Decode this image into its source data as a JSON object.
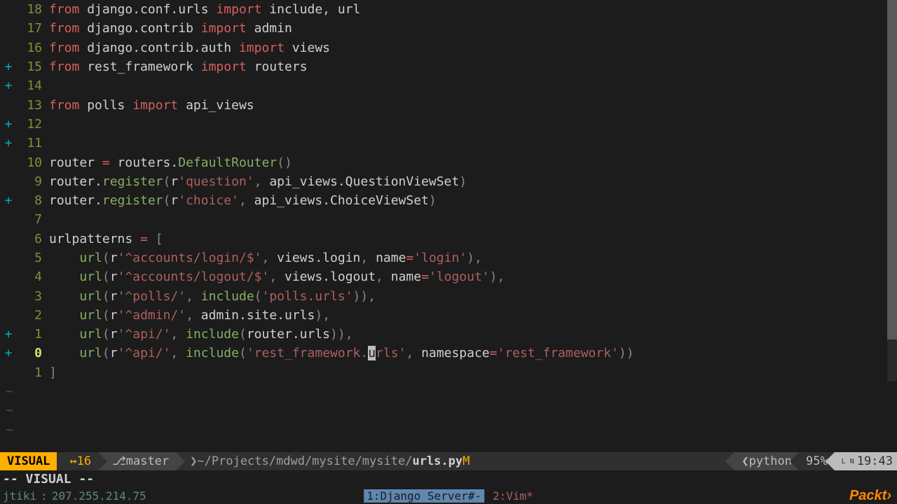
{
  "lines": [
    {
      "sign": "",
      "num": "18",
      "tokens": [
        {
          "c": "kw",
          "t": "from"
        },
        {
          "c": "ident",
          "t": " django.conf.urls "
        },
        {
          "c": "kw",
          "t": "import"
        },
        {
          "c": "ident",
          "t": " include, url"
        }
      ]
    },
    {
      "sign": "",
      "num": "17",
      "tokens": [
        {
          "c": "kw",
          "t": "from"
        },
        {
          "c": "ident",
          "t": " django.contrib "
        },
        {
          "c": "kw",
          "t": "import"
        },
        {
          "c": "ident",
          "t": " admin"
        }
      ]
    },
    {
      "sign": "",
      "num": "16",
      "tokens": [
        {
          "c": "kw",
          "t": "from"
        },
        {
          "c": "ident",
          "t": " django.contrib.auth "
        },
        {
          "c": "kw",
          "t": "import"
        },
        {
          "c": "ident",
          "t": " views"
        }
      ]
    },
    {
      "sign": "+",
      "num": "15",
      "tokens": [
        {
          "c": "kw",
          "t": "from"
        },
        {
          "c": "ident",
          "t": " rest_framework "
        },
        {
          "c": "kw",
          "t": "import"
        },
        {
          "c": "ident",
          "t": " routers"
        }
      ]
    },
    {
      "sign": "+",
      "num": "14",
      "tokens": []
    },
    {
      "sign": "",
      "num": "13",
      "tokens": [
        {
          "c": "kw",
          "t": "from"
        },
        {
          "c": "ident",
          "t": " polls "
        },
        {
          "c": "kw",
          "t": "import"
        },
        {
          "c": "ident",
          "t": " api_views"
        }
      ]
    },
    {
      "sign": "+",
      "num": "12",
      "tokens": []
    },
    {
      "sign": "+",
      "num": "11",
      "tokens": []
    },
    {
      "sign": "",
      "num": "10",
      "tokens": [
        {
          "c": "ident",
          "t": "router "
        },
        {
          "c": "op",
          "t": "="
        },
        {
          "c": "ident",
          "t": " routers."
        },
        {
          "c": "func",
          "t": "DefaultRouter"
        },
        {
          "c": "punct",
          "t": "()"
        }
      ]
    },
    {
      "sign": "",
      "num": "9",
      "tokens": [
        {
          "c": "ident",
          "t": "router."
        },
        {
          "c": "func",
          "t": "register"
        },
        {
          "c": "punct",
          "t": "("
        },
        {
          "c": "ident",
          "t": "r"
        },
        {
          "c": "str",
          "t": "'question'"
        },
        {
          "c": "punct",
          "t": ", "
        },
        {
          "c": "ident",
          "t": "api_views.QuestionViewSet"
        },
        {
          "c": "punct",
          "t": ")"
        }
      ]
    },
    {
      "sign": "+",
      "num": "8",
      "tokens": [
        {
          "c": "ident",
          "t": "router."
        },
        {
          "c": "func",
          "t": "register"
        },
        {
          "c": "punct",
          "t": "("
        },
        {
          "c": "ident",
          "t": "r"
        },
        {
          "c": "str",
          "t": "'choice'"
        },
        {
          "c": "punct",
          "t": ", "
        },
        {
          "c": "ident",
          "t": "api_views.ChoiceViewSet"
        },
        {
          "c": "punct",
          "t": ")"
        }
      ]
    },
    {
      "sign": "",
      "num": "7",
      "tokens": []
    },
    {
      "sign": "",
      "num": "6",
      "tokens": [
        {
          "c": "ident",
          "t": "urlpatterns "
        },
        {
          "c": "op",
          "t": "="
        },
        {
          "c": "ident",
          "t": " "
        },
        {
          "c": "punct",
          "t": "["
        }
      ]
    },
    {
      "sign": "",
      "num": "5",
      "tokens": [
        {
          "c": "ident",
          "t": "    "
        },
        {
          "c": "func",
          "t": "url"
        },
        {
          "c": "punct",
          "t": "("
        },
        {
          "c": "ident",
          "t": "r"
        },
        {
          "c": "str",
          "t": "'^accounts/login/$'"
        },
        {
          "c": "punct",
          "t": ", "
        },
        {
          "c": "ident",
          "t": "views.login"
        },
        {
          "c": "punct",
          "t": ", "
        },
        {
          "c": "ident",
          "t": "name"
        },
        {
          "c": "op",
          "t": "="
        },
        {
          "c": "str",
          "t": "'login'"
        },
        {
          "c": "punct",
          "t": "),"
        }
      ]
    },
    {
      "sign": "",
      "num": "4",
      "tokens": [
        {
          "c": "ident",
          "t": "    "
        },
        {
          "c": "func",
          "t": "url"
        },
        {
          "c": "punct",
          "t": "("
        },
        {
          "c": "ident",
          "t": "r"
        },
        {
          "c": "str",
          "t": "'^accounts/logout/$'"
        },
        {
          "c": "punct",
          "t": ", "
        },
        {
          "c": "ident",
          "t": "views.logout"
        },
        {
          "c": "punct",
          "t": ", "
        },
        {
          "c": "ident",
          "t": "name"
        },
        {
          "c": "op",
          "t": "="
        },
        {
          "c": "str",
          "t": "'logout'"
        },
        {
          "c": "punct",
          "t": "),"
        }
      ]
    },
    {
      "sign": "",
      "num": "3",
      "tokens": [
        {
          "c": "ident",
          "t": "    "
        },
        {
          "c": "func",
          "t": "url"
        },
        {
          "c": "punct",
          "t": "("
        },
        {
          "c": "ident",
          "t": "r"
        },
        {
          "c": "str",
          "t": "'^polls/'"
        },
        {
          "c": "punct",
          "t": ", "
        },
        {
          "c": "func",
          "t": "include"
        },
        {
          "c": "punct",
          "t": "("
        },
        {
          "c": "str",
          "t": "'polls.urls'"
        },
        {
          "c": "punct",
          "t": ")),"
        }
      ]
    },
    {
      "sign": "",
      "num": "2",
      "tokens": [
        {
          "c": "ident",
          "t": "    "
        },
        {
          "c": "func",
          "t": "url"
        },
        {
          "c": "punct",
          "t": "("
        },
        {
          "c": "ident",
          "t": "r"
        },
        {
          "c": "str",
          "t": "'^admin/'"
        },
        {
          "c": "punct",
          "t": ", "
        },
        {
          "c": "ident",
          "t": "admin.site.urls"
        },
        {
          "c": "punct",
          "t": "),"
        }
      ]
    },
    {
      "sign": "+",
      "num": "1",
      "tokens": [
        {
          "c": "ident",
          "t": "    "
        },
        {
          "c": "func",
          "t": "url"
        },
        {
          "c": "punct",
          "t": "("
        },
        {
          "c": "ident",
          "t": "r"
        },
        {
          "c": "str",
          "t": "'^api/'"
        },
        {
          "c": "punct",
          "t": ", "
        },
        {
          "c": "func",
          "t": "include"
        },
        {
          "c": "punct",
          "t": "("
        },
        {
          "c": "ident",
          "t": "router.urls"
        },
        {
          "c": "punct",
          "t": ")),"
        }
      ]
    },
    {
      "sign": "+",
      "num": "0",
      "current": true,
      "tokens": [
        {
          "c": "ident",
          "t": "    "
        },
        {
          "c": "func",
          "t": "url"
        },
        {
          "c": "punct",
          "t": "("
        },
        {
          "c": "ident",
          "t": "r"
        },
        {
          "c": "str",
          "t": "'^api/'"
        },
        {
          "c": "punct",
          "t": ", "
        },
        {
          "c": "func",
          "t": "include"
        },
        {
          "c": "punct",
          "t": "("
        },
        {
          "c": "str",
          "t": "'rest_framework."
        },
        {
          "c": "cursor-block",
          "t": "u"
        },
        {
          "c": "str",
          "t": "rls'"
        },
        {
          "c": "punct",
          "t": ", "
        },
        {
          "c": "ident",
          "t": "namespace"
        },
        {
          "c": "op",
          "t": "="
        },
        {
          "c": "str",
          "t": "'rest_framework'"
        },
        {
          "c": "punct",
          "t": "))"
        }
      ]
    },
    {
      "sign": "",
      "num": "1",
      "tokens": [
        {
          "c": "punct",
          "t": "]"
        }
      ]
    }
  ],
  "tilde_rows": 3,
  "status": {
    "mode": "VISUAL",
    "line_delta": "↔16",
    "branch_icon": "⎇",
    "branch": "master",
    "path_prefix": "~/Projects/mdwd/mysite/mysite/",
    "path_file": "urls.py",
    "modified": "M",
    "filetype_icon": "❮",
    "filetype": "python",
    "percent": "95%",
    "ln_label": "L\nN",
    "line": "19",
    "col": "43"
  },
  "cmdline": "-- VISUAL --",
  "tmux": {
    "session": "jtiki",
    "host": "207.255.214.75",
    "win_active": "1:Django Server#-",
    "win_other": "2:Vim*",
    "logo": "Packt›"
  }
}
